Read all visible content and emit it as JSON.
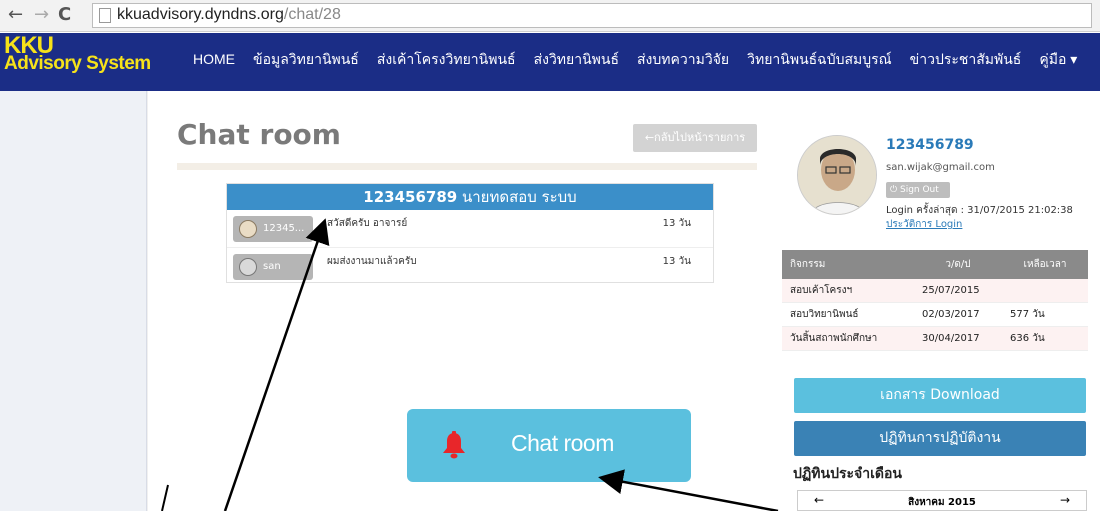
{
  "browser": {
    "url_host": "kkuadvisory.dyndns.org",
    "url_path": "/chat/28",
    "back_glyph": "←",
    "forward_glyph": "→",
    "reload_glyph": "C"
  },
  "brand": {
    "line1": "KKU",
    "line2": "Advisory System",
    "color": "#f6e21a"
  },
  "nav": {
    "items": [
      "HOME",
      "ข้อมูลวิทยานิพนธ์",
      "ส่งเค้าโครงวิทยานิพนธ์",
      "ส่งวิทยานิพนธ์",
      "ส่งบทความวิจัย",
      "วิทยานิพนธ์ฉบับสมบูรณ์",
      "ข่าวประชาสัมพันธ์",
      "คู่มือ ▾"
    ],
    "color": "#1b2d86"
  },
  "page": {
    "title": "Chat room",
    "back_button": "←กลับไปหน้ารายการ"
  },
  "chat": {
    "header_id": "123456789",
    "header_name": "นายทดสอบ ระบบ",
    "rows": [
      {
        "user": "12345...",
        "message": "สวัสดีครับ อาจารย์",
        "time": "13 วัน"
      },
      {
        "user": "san",
        "message": "ผมส่งงานมาแล้วครับ",
        "time": "13 วัน"
      }
    ],
    "header_color": "#3b8fc9"
  },
  "callout": {
    "label": "Chat room",
    "icon": "bell-icon",
    "color": "#5bc0de",
    "icon_color": "#e8262a"
  },
  "profile": {
    "id": "123456789",
    "email": "san.wijak@gmail.com",
    "signout": "⏻ Sign Out",
    "last_login": "Login ครั้งล่าสุด : 31/07/2015 21:02:38",
    "history_link": "ประวัติการ Login"
  },
  "activity": {
    "headers": [
      "กิจกรรม",
      "ว/ด/ป",
      "เหลือเวลา"
    ],
    "rows": [
      {
        "activity": "สอบเค้าโครงฯ",
        "date": "25/07/2015",
        "remaining": ""
      },
      {
        "activity": "สอบวิทยานิพนธ์",
        "date": "02/03/2017",
        "remaining": "577 วัน"
      },
      {
        "activity": "วันสิ้นสถาพนักศึกษา",
        "date": "30/04/2017",
        "remaining": "636 วัน"
      }
    ]
  },
  "side_buttons": {
    "download": "เอกสาร Download",
    "schedule": "ปฏิทินการปฏิบัติงาน"
  },
  "calendar": {
    "heading": "ปฏิทินประจำเดือน",
    "month": "สิงหาคม 2015",
    "prev": "←",
    "next": "→"
  }
}
